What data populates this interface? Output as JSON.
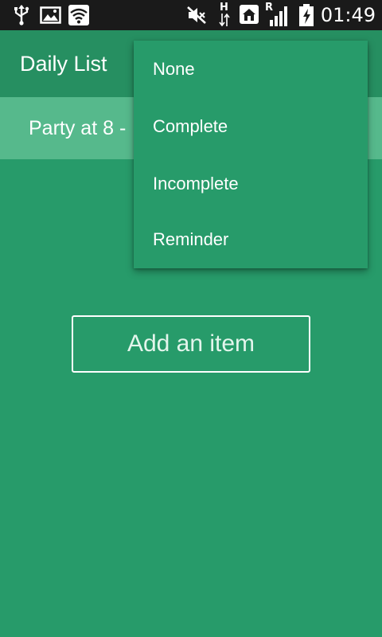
{
  "status_bar": {
    "time": "01:49",
    "icons": [
      "usb-icon",
      "image-icon",
      "wifi-icon",
      "mute-icon",
      "network-h-icon",
      "home-icon",
      "signal-roaming-icon",
      "battery-charging-icon"
    ],
    "network_label": "H",
    "roaming_label": "R"
  },
  "app_bar": {
    "title": "Daily List"
  },
  "list": {
    "items": [
      {
        "text": "Party at 8 -"
      }
    ]
  },
  "add_button": {
    "label": "Add an item"
  },
  "menu": {
    "items": [
      {
        "label": "None"
      },
      {
        "label": "Complete"
      },
      {
        "label": "Incomplete"
      },
      {
        "label": "Reminder"
      }
    ]
  },
  "colors": {
    "background": "#279b6a",
    "app_bar": "#268f61",
    "list_item": "#56b98c",
    "status_bar": "#1a1a1a",
    "text": "#ffffff"
  }
}
